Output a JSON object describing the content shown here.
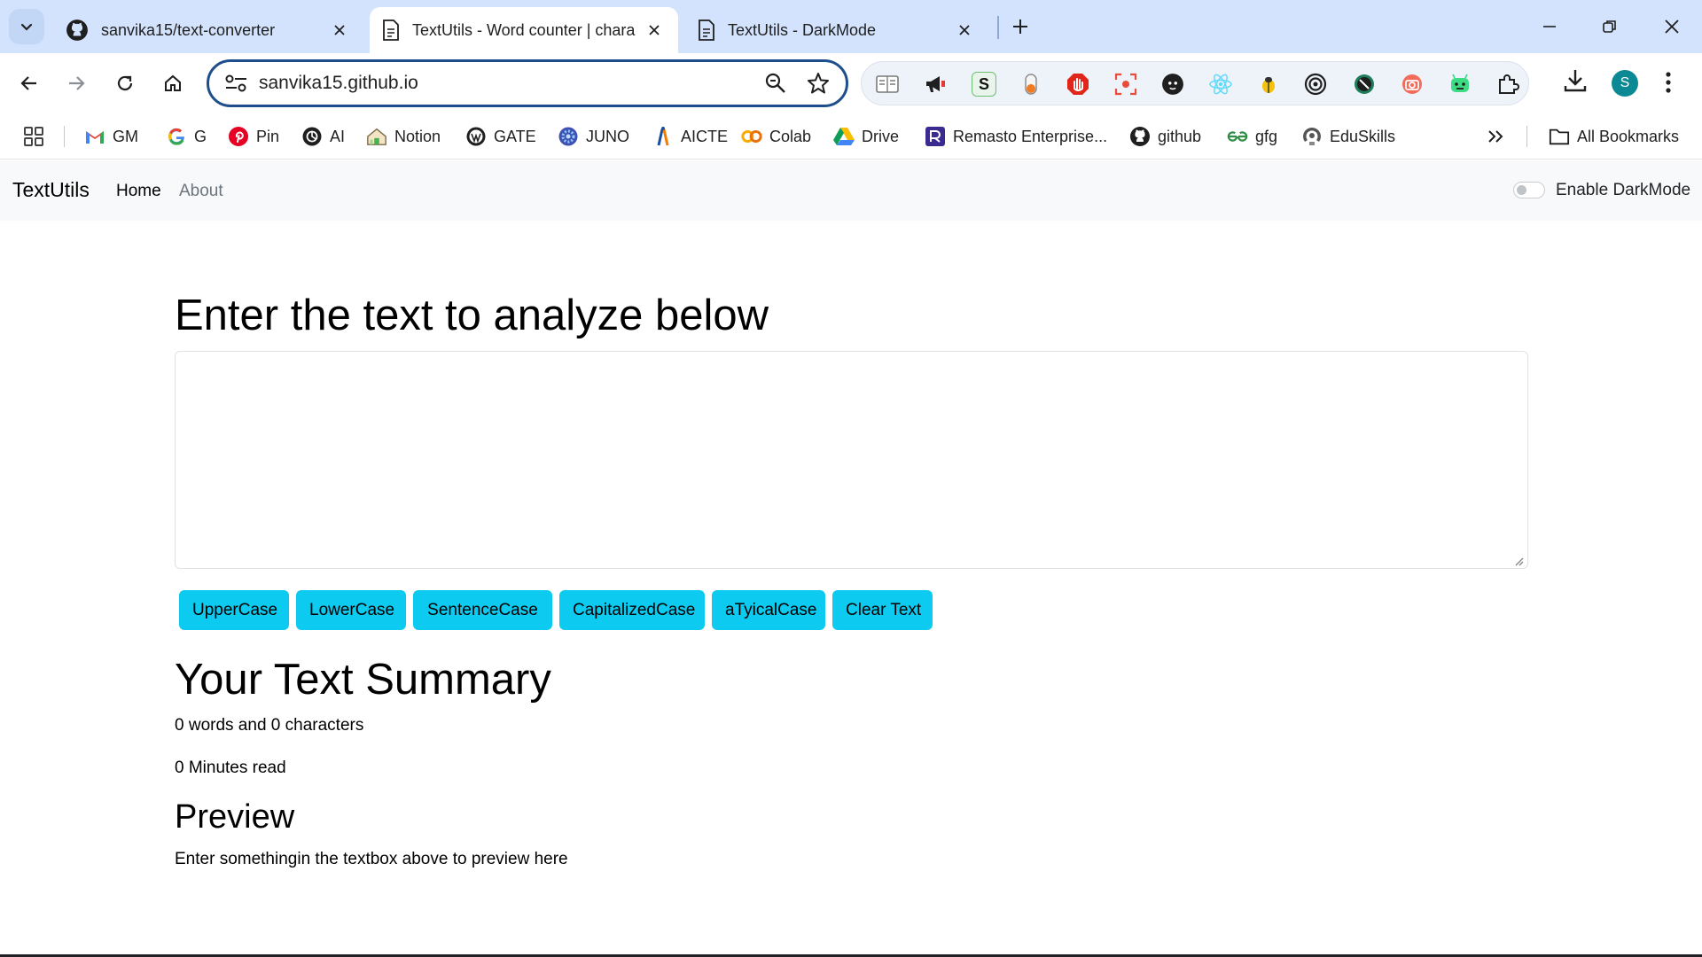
{
  "browser": {
    "tabs": [
      {
        "title": "sanvika15/text-converter",
        "icon": "github-icon",
        "active": false
      },
      {
        "title": "TextUtils - Word counter | character counter | Remove extra spaces",
        "icon": "document-icon",
        "active": true
      },
      {
        "title": "TextUtils - DarkMode",
        "icon": "document-icon",
        "active": false
      }
    ],
    "url": "sanvika15.github.io",
    "avatar_letter": "S",
    "extensions": [
      "reader-mode-icon",
      "megaphone-icon",
      "s-extension-icon",
      "pill-icon",
      "adblock-hand-icon",
      "screenshot-icon",
      "github-cat-icon",
      "react-icon",
      "bug-icon",
      "target-icon",
      "wordpress-icon",
      "camera-icon",
      "android-icon",
      "puzzle-icon"
    ],
    "bookmarks": [
      {
        "label": "GM",
        "icon": "gmail-icon"
      },
      {
        "label": "G",
        "icon": "google-icon"
      },
      {
        "label": "Pin",
        "icon": "pinterest-icon"
      },
      {
        "label": "AI",
        "icon": "openai-icon"
      },
      {
        "label": "Notion",
        "icon": "notion-icon"
      },
      {
        "label": "GATE",
        "icon": "gate-icon"
      },
      {
        "label": "JUNO",
        "icon": "juno-icon"
      },
      {
        "label": "AICTE",
        "icon": "aicte-icon"
      },
      {
        "label": "Colab",
        "icon": "colab-icon"
      },
      {
        "label": "Drive",
        "icon": "drive-icon"
      },
      {
        "label": "Remasto Enterprise...",
        "icon": "remasto-icon"
      },
      {
        "label": "github",
        "icon": "github-icon"
      },
      {
        "label": "gfg",
        "icon": "gfg-icon"
      },
      {
        "label": "EduSkills",
        "icon": "eduskills-icon"
      }
    ],
    "all_bookmarks_label": "All Bookmarks"
  },
  "page": {
    "brand": "TextUtils",
    "nav": {
      "home": "Home",
      "about": "About"
    },
    "darkmode_label": "Enable DarkMode",
    "darkmode_enabled": false,
    "heading": "Enter the text to analyze below",
    "textarea_value": "",
    "buttons": [
      "UpperCase",
      "LowerCase",
      "SentenceCase",
      "CapitalizedCase",
      "aTyicalCase",
      "Clear Text"
    ],
    "summary_heading": "Your Text Summary",
    "counts_text": "0 words and 0 characters",
    "readtime_text": "0 Minutes read",
    "preview_heading": "Preview",
    "preview_text": "Enter somethingin the textbox above to preview here"
  },
  "colors": {
    "button": "#0dcaf0",
    "tabstrip": "#d3e3fd",
    "navbar": "#f8f9fa",
    "avatar": "#0b8a96"
  }
}
